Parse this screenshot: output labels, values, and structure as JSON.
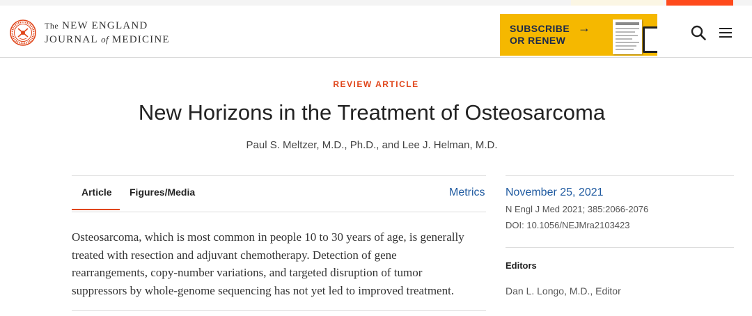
{
  "header": {
    "logo": {
      "line1_prefix": "The",
      "line1_main": "NEW ENGLAND",
      "line2_a": "JOURNAL",
      "line2_of": "of",
      "line2_b": "MEDICINE"
    },
    "subscribe": {
      "line1": "SUBSCRIBE",
      "line2": "OR RENEW",
      "arrow": "→"
    },
    "icons": {
      "search": "search-icon",
      "menu": "hamburger-menu-icon",
      "seal": "nejm-seal-logo"
    },
    "colors": {
      "accent": "#e0461b",
      "subscribe_bg": "#f5b800",
      "link": "#1f5aa0",
      "top_red": "#ff4a1c"
    }
  },
  "article": {
    "type_label": "REVIEW ARTICLE",
    "title": "New Horizons in the Treatment of Osteosarcoma",
    "authors": "Paul S. Meltzer, M.D., Ph.D., and Lee J. Helman, M.D.",
    "tabs": [
      {
        "label": "Article",
        "active": true
      },
      {
        "label": "Figures/Media",
        "active": false
      }
    ],
    "metrics_link": "Metrics",
    "abstract_lines": [
      "Osteosarcoma, which is most common in people 10 to 30 years of age, is generally",
      "treated with resection and adjuvant chemotherapy. Detection of gene",
      "rearrangements, copy-number variations, and targeted disruption of tumor",
      "suppressors by whole-genome sequencing has not yet led to improved treatment."
    ]
  },
  "sidebar": {
    "date": "November 25, 2021",
    "citation": "N Engl J Med 2021; 385:2066-2076",
    "doi": "DOI: 10.1056/NEJMra2103423",
    "editors_heading": "Editors",
    "editor": "Dan L. Longo, M.D., Editor"
  }
}
